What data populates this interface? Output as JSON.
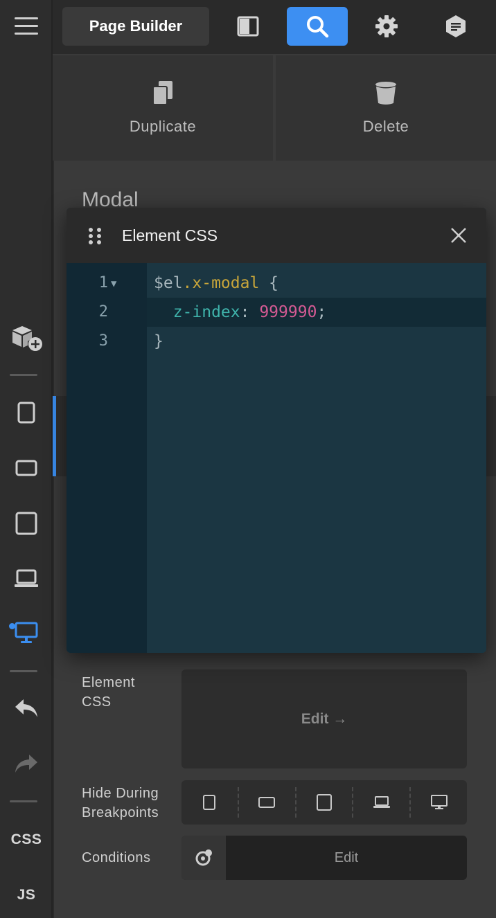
{
  "topbar": {
    "title": "Page Builder",
    "icons": [
      "layout-panel-icon",
      "search-icon",
      "gear-icon",
      "notes-hex-icon"
    ]
  },
  "actions": {
    "duplicate_label": "Duplicate",
    "delete_label": "Delete"
  },
  "panel": {
    "title": "Modal",
    "element_css_label_line1": "Element",
    "element_css_label_line2": "CSS",
    "edit_label": "Edit →",
    "hide_breakpoints_line1": "Hide During",
    "hide_breakpoints_line2": "Breakpoints",
    "conditions_label": "Conditions",
    "conditions_edit": "Edit"
  },
  "rail": {
    "css_label": "CSS",
    "js_label": "JS"
  },
  "modal": {
    "title": "Element CSS",
    "code": [
      {
        "num": "1",
        "parts": [
          {
            "cls": "c-var",
            "t": "$el"
          },
          {
            "cls": "c-sel",
            "t": ".x-modal"
          },
          {
            "cls": "c-punct",
            "t": " {"
          }
        ]
      },
      {
        "num": "2",
        "parts": [
          {
            "cls": "c-prop",
            "t": "  z-index"
          },
          {
            "cls": "c-punct",
            "t": ": "
          },
          {
            "cls": "c-num",
            "t": "999990"
          },
          {
            "cls": "c-punct",
            "t": ";"
          }
        ]
      },
      {
        "num": "3",
        "parts": [
          {
            "cls": "c-punct",
            "t": "}"
          }
        ]
      }
    ]
  },
  "colors": {
    "accent": "#3d8ff2",
    "modal_bg": "#1b3642",
    "gutter_bg": "#112834",
    "selector": "#c9a63a",
    "property": "#3fb3ab",
    "number": "#d45a93"
  }
}
